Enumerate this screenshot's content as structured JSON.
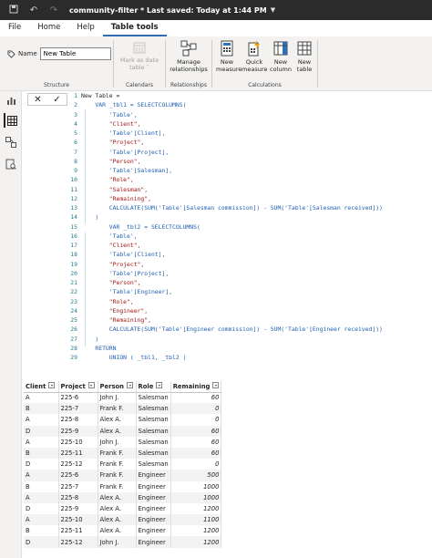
{
  "titlebar": {
    "title": "community-filter * Last saved: Today at 1:44 PM"
  },
  "menu": {
    "file": "File",
    "home": "Home",
    "help": "Help",
    "table_tools": "Table tools"
  },
  "ribbon": {
    "name_label": "Name",
    "name_value": "New Table",
    "structure_label": "Structure",
    "mark_as_date": "Mark as date table",
    "calendars_label": "Calendars",
    "manage_relationships": "Manage relationships",
    "relationships_label": "Relationships",
    "new_measure": "New measure",
    "quick_measure": "Quick measure",
    "new_column": "New column",
    "new_table": "New table",
    "calculations_label": "Calculations"
  },
  "formula": {
    "lines": [
      {
        "n": "1",
        "t": "New Table ="
      },
      {
        "n": "2",
        "t": "    VAR _tbl1 = SELECTCOLUMNS("
      },
      {
        "n": "3",
        "t": "        'Table',"
      },
      {
        "n": "4",
        "t": "        \"Client\","
      },
      {
        "n": "5",
        "t": "        'Table'[Client],"
      },
      {
        "n": "6",
        "t": "        \"Project\","
      },
      {
        "n": "7",
        "t": "        'Table'[Project],"
      },
      {
        "n": "8",
        "t": "        \"Person\","
      },
      {
        "n": "9",
        "t": "        'Table'[Salesman],"
      },
      {
        "n": "10",
        "t": "        \"Role\","
      },
      {
        "n": "11",
        "t": "        \"Salesman\","
      },
      {
        "n": "12",
        "t": "        \"Remaining\","
      },
      {
        "n": "13",
        "t": "        CALCULATE(SUM('Table'[Salesman commission]) - SUM('Table'[Salesman received]))"
      },
      {
        "n": "14",
        "t": "    )"
      },
      {
        "n": "15",
        "t": "        VAR _tbl2 = SELECTCOLUMNS("
      },
      {
        "n": "16",
        "t": "        'Table',"
      },
      {
        "n": "17",
        "t": "        \"Client\","
      },
      {
        "n": "18",
        "t": "        'Table'[Client],"
      },
      {
        "n": "19",
        "t": "        \"Project\","
      },
      {
        "n": "20",
        "t": "        'Table'[Project],"
      },
      {
        "n": "21",
        "t": "        \"Person\","
      },
      {
        "n": "22",
        "t": "        'Table'[Engineer],"
      },
      {
        "n": "23",
        "t": "        \"Role\","
      },
      {
        "n": "24",
        "t": "        \"Engineer\","
      },
      {
        "n": "25",
        "t": "        \"Remaining\","
      },
      {
        "n": "26",
        "t": "        CALCULATE(SUM('Table'[Engineer commission]) - SUM('Table'[Engineer received]))"
      },
      {
        "n": "27",
        "t": "    )"
      },
      {
        "n": "28",
        "t": "    RETURN"
      },
      {
        "n": "29",
        "t": "        UNION ( _tbl1, _tbl2 )"
      }
    ]
  },
  "table": {
    "headers": [
      "Client",
      "Project",
      "Person",
      "Role",
      "Remaining"
    ],
    "rows": [
      [
        "A",
        "225-6",
        "John J.",
        "Salesman",
        "60"
      ],
      [
        "B",
        "225-7",
        "Frank F.",
        "Salesman",
        "0"
      ],
      [
        "A",
        "225-8",
        "Alex A.",
        "Salesman",
        "0"
      ],
      [
        "D",
        "225-9",
        "Alex A.",
        "Salesman",
        "60"
      ],
      [
        "A",
        "225-10",
        "John J.",
        "Salesman",
        "60"
      ],
      [
        "B",
        "225-11",
        "Frank F.",
        "Salesman",
        "60"
      ],
      [
        "D",
        "225-12",
        "Frank F.",
        "Salesman",
        "0"
      ],
      [
        "A",
        "225-6",
        "Frank F.",
        "Engineer",
        "500"
      ],
      [
        "B",
        "225-7",
        "Frank F.",
        "Engineer",
        "1000"
      ],
      [
        "A",
        "225-8",
        "Alex A.",
        "Engineer",
        "1000"
      ],
      [
        "D",
        "225-9",
        "Alex A.",
        "Engineer",
        "1200"
      ],
      [
        "A",
        "225-10",
        "Alex A.",
        "Engineer",
        "1100"
      ],
      [
        "B",
        "225-11",
        "Alex A.",
        "Engineer",
        "1200"
      ],
      [
        "D",
        "225-12",
        "John J.",
        "Engineer",
        "1200"
      ]
    ]
  }
}
